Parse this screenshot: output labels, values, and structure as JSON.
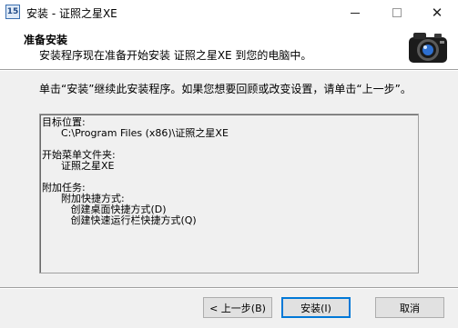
{
  "window": {
    "title": "安装 - 证照之星XE",
    "icon_text": "15",
    "controls": {
      "minimize": "minimize-icon",
      "maximize": "maximize-icon",
      "close": "close-icon"
    }
  },
  "header": {
    "title": "准备安装",
    "subtitle": "安装程序现在准备开始安装 证照之星XE 到您的电脑中。",
    "logo": "camera-icon"
  },
  "intro": "单击“安装”继续此安装程序。如果您想要回顾或改变设置，请单击“上一步”。",
  "summary": {
    "lines": [
      "目标位置:",
      "      C:\\Program Files (x86)\\证照之星XE",
      "",
      "开始菜单文件夹:",
      "      证照之星XE",
      "",
      "附加任务:",
      "      附加快捷方式:",
      "         创建桌面快捷方式(D)",
      "         创建快速运行栏快捷方式(Q)"
    ]
  },
  "buttons": {
    "back": "< 上一步(B)",
    "install": "安装(I)",
    "cancel": "取消"
  },
  "colors": {
    "accent": "#0078d7",
    "panel": "#f0f0f0"
  }
}
